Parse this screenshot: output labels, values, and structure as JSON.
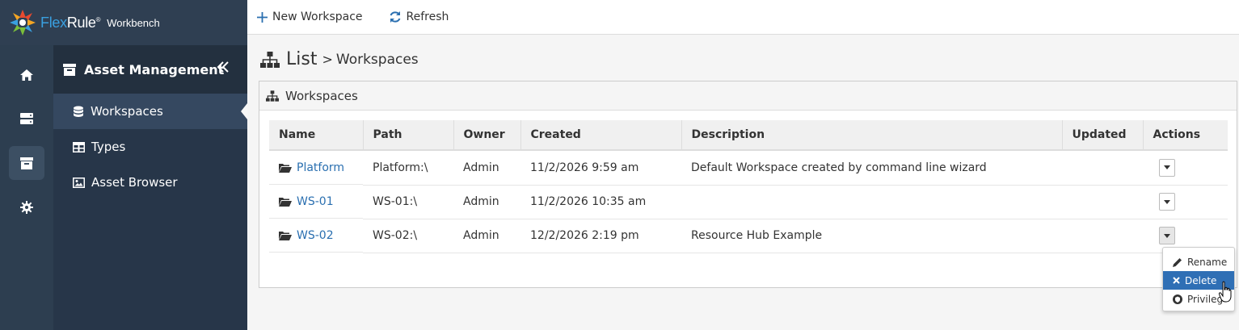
{
  "brand": {
    "flex": "Flex",
    "rule": "Rule",
    "reg": "®",
    "workbench": "Workbench"
  },
  "rail": {
    "items": [
      "home-icon",
      "server-icon",
      "archive-icon",
      "gear-icon"
    ],
    "active_index": 2
  },
  "menu": {
    "title": "Asset Management",
    "collapse_icon": "double-chevron-left-icon",
    "items": [
      {
        "label": "Workspaces",
        "icon": "database-icon",
        "active": true
      },
      {
        "label": "Types",
        "icon": "table-icon"
      },
      {
        "label": "Asset Browser",
        "icon": "image-icon"
      }
    ]
  },
  "toolbar": {
    "new_label": "New Workspace",
    "refresh_label": "Refresh"
  },
  "page": {
    "title": "List",
    "separator": ">",
    "subtitle": "Workspaces"
  },
  "panel": {
    "title": "Workspaces"
  },
  "table": {
    "headers": [
      "Name",
      "Path",
      "Owner",
      "Created",
      "Description",
      "Updated",
      "Actions"
    ],
    "rows": [
      {
        "name": "Platform",
        "path": "Platform:\\",
        "owner": "Admin",
        "created": "11/2/2026 9:59 am",
        "description": "Default Workspace created by command line wizard",
        "updated": ""
      },
      {
        "name": "WS-01",
        "path": "WS-01:\\",
        "owner": "Admin",
        "created": "11/2/2026 10:35 am",
        "description": "",
        "updated": ""
      },
      {
        "name": "WS-02",
        "path": "WS-02:\\",
        "owner": "Admin",
        "created": "12/2/2026 2:19 pm",
        "description": "Resource Hub Example",
        "updated": ""
      }
    ]
  },
  "dropdown": {
    "rename": "Rename",
    "delete": "Delete",
    "privileges": "Privileg"
  },
  "colors": {
    "sidebar": "#2d3e50",
    "menu": "#273649",
    "link": "#2a6fb0",
    "selected": "#2f6fb5"
  }
}
